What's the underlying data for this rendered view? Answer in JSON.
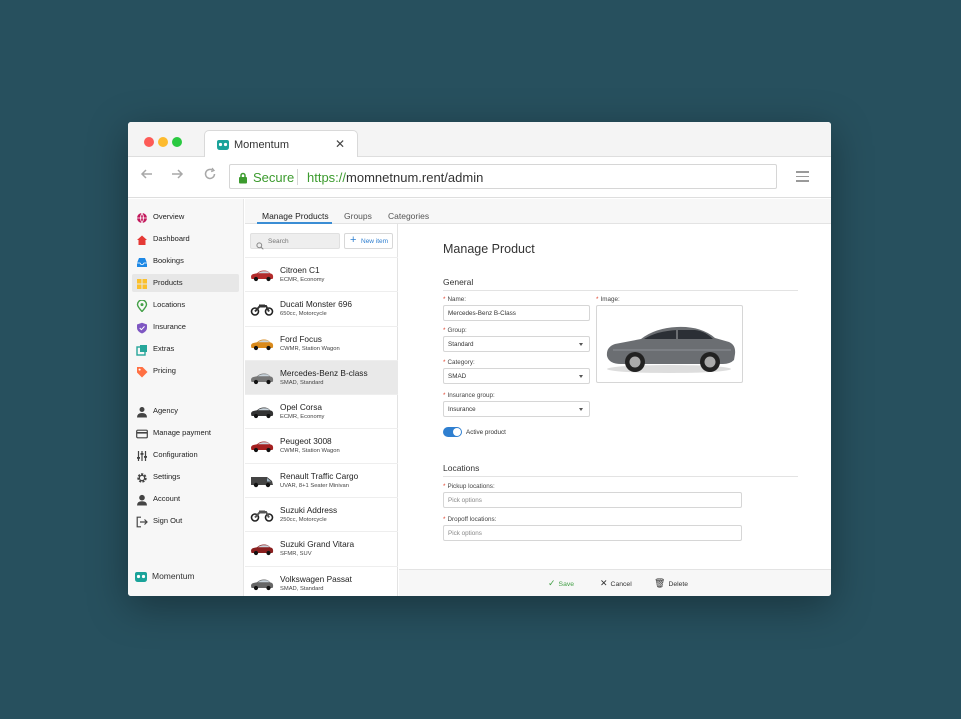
{
  "browser": {
    "tab_title": "Momentum",
    "tab_close": "✕",
    "secure_label": "Secure",
    "url_scheme": "https://",
    "url_rest": "momnetnum.rent/admin"
  },
  "sidebar": {
    "items": [
      {
        "label": "Overview",
        "icon": "globe-icon",
        "color": "#c2185b"
      },
      {
        "label": "Dashboard",
        "icon": "home-icon",
        "color": "#e53935"
      },
      {
        "label": "Bookings",
        "icon": "inbox-icon",
        "color": "#1e88e5"
      },
      {
        "label": "Products",
        "icon": "grid-icon",
        "color": "#fbc02d"
      },
      {
        "label": "Locations",
        "icon": "location-pin-icon",
        "color": "#43a047"
      },
      {
        "label": "Insurance",
        "icon": "shield-icon",
        "color": "#7e57c2"
      },
      {
        "label": "Extras",
        "icon": "extras-icon",
        "color": "#26a69a"
      },
      {
        "label": "Pricing",
        "icon": "tag-icon",
        "color": "#ff7043"
      },
      {
        "label": "Agency",
        "icon": "person-icon",
        "color": "#444444"
      },
      {
        "label": "Manage payment",
        "icon": "credit-card-icon",
        "color": "#444444"
      },
      {
        "label": "Configuration",
        "icon": "sliders-icon",
        "color": "#444444"
      },
      {
        "label": "Settings",
        "icon": "gear-icon",
        "color": "#444444"
      },
      {
        "label": "Account",
        "icon": "account-icon",
        "color": "#444444"
      },
      {
        "label": "Sign Out",
        "icon": "sign-out-icon",
        "color": "#444444"
      }
    ],
    "active_index": 3,
    "footer_label": "Momentum"
  },
  "tabs": [
    "Manage Products",
    "Groups",
    "Categories"
  ],
  "list": {
    "search_placeholder": "Search",
    "new_item_plus": "+",
    "new_item_label": "New item",
    "products": [
      {
        "name": "Citroen C1",
        "desc": "ECMR, Economy",
        "color": "#b32b2b",
        "type": "car"
      },
      {
        "name": "Ducati Monster 696",
        "desc": "650cc, Motorcycle",
        "color": "#333333",
        "type": "motorcycle"
      },
      {
        "name": "Ford Focus",
        "desc": "CWMR, Station Wagon",
        "color": "#d98a1c",
        "type": "car"
      },
      {
        "name": "Mercedes-Benz B-class",
        "desc": "SMAD, Standard",
        "color": "#777777",
        "type": "car"
      },
      {
        "name": "Opel Corsa",
        "desc": "ECMR, Economy",
        "color": "#333333",
        "type": "car"
      },
      {
        "name": "Peugeot 3008",
        "desc": "CWMR, Station Wagon",
        "color": "#a52020",
        "type": "car"
      },
      {
        "name": "Renault Traffic Cargo",
        "desc": "UVAR, 8+1 Seater Minivan",
        "color": "#444444",
        "type": "van"
      },
      {
        "name": "Suzuki Address",
        "desc": "250cc, Motorcycle",
        "color": "#555555",
        "type": "scooter"
      },
      {
        "name": "Suzuki Grand Vitara",
        "desc": "SFMR, SUV",
        "color": "#8a1f1f",
        "type": "car"
      },
      {
        "name": "Volkswagen Passat",
        "desc": "SMAD, Standard",
        "color": "#666666",
        "type": "car"
      }
    ],
    "selected_index": 3
  },
  "detail": {
    "title": "Manage Product",
    "general_title": "General",
    "name_label": "Name:",
    "name_value": "Mercedes-Benz B-Class",
    "image_label": "Image:",
    "group_label": "Group:",
    "group_value": "Standard",
    "category_label": "Category:",
    "category_value": "SMAD",
    "insurance_label": "Insurance group:",
    "insurance_value": "Insurance",
    "active_label": "Active product",
    "active_on": true,
    "locations_title": "Locations",
    "pickup_label": "Pickup locations:",
    "pickup_placeholder": "Pick options",
    "dropoff_label": "Dropoff locations:",
    "dropoff_placeholder": "Pick options",
    "required_mark": "*"
  },
  "actions": {
    "save": "Save",
    "cancel": "Cancel",
    "delete": "Delete",
    "save_color": "#43a047"
  },
  "colors": {
    "accent": "#2f7fd0",
    "secure_green": "#3c9b2e",
    "brand_teal": "#1aa39a"
  }
}
